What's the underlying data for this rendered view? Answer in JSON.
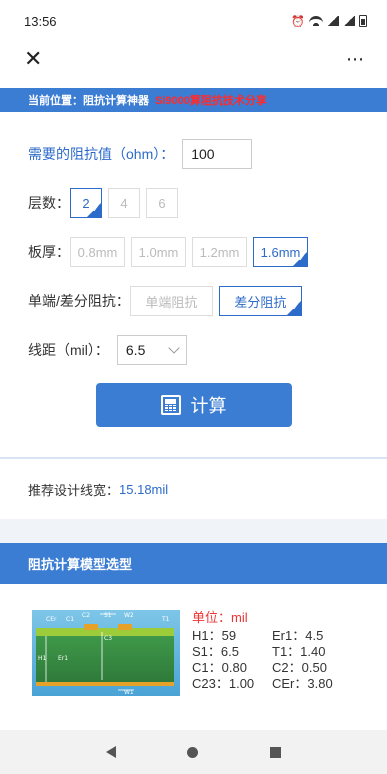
{
  "status": {
    "time": "13:56"
  },
  "breadcrumb": {
    "prefix": "当前位置：阻抗计算神器",
    "highlight": "Si9000算阻抗技术分享"
  },
  "form": {
    "impedance_label": "需要的阻抗值（ohm）：",
    "impedance_value": "100",
    "layers_label": "层数：",
    "layers": [
      "2",
      "4",
      "6"
    ],
    "layers_selected": 0,
    "thickness_label": "板厚：",
    "thickness": [
      "0.8mm",
      "1.0mm",
      "1.2mm",
      "1.6mm"
    ],
    "mode_label": "单端/差分阻抗：",
    "modes": [
      "单端阻抗",
      "差分阻抗"
    ],
    "spacing_label": "线距（mil）：",
    "spacing_value": "6.5",
    "calc_button": "计算"
  },
  "result": {
    "label": "推荐设计线宽：",
    "value": "15.18mil"
  },
  "model": {
    "title": "阻抗计算模型选型",
    "unit": "单位：mil",
    "params": [
      [
        "H1：59",
        "Er1：4.5"
      ],
      [
        "S1：6.5",
        "T1：1.40"
      ],
      [
        "C1：0.80",
        "C2：0.50"
      ],
      [
        "C23：1.00",
        "CEr：3.80"
      ]
    ],
    "diagram_labels": {
      "ce": "CEr",
      "c1": "C1",
      "c2": "C2",
      "s1": "S1",
      "w2": "W2",
      "t1": "T1",
      "c3": "C3",
      "h1": "H1",
      "er1": "Er1",
      "w1": "W1"
    }
  },
  "icons": {
    "close": "close-icon",
    "more": "more-icon",
    "calculator": "calculator-icon",
    "back": "back-icon",
    "home": "home-icon",
    "recent": "recent-apps-icon"
  },
  "colors": {
    "brand_blue": "#3c7dd4",
    "accent_red": "#ff2a2a",
    "value_blue": "#2c6bc9"
  }
}
